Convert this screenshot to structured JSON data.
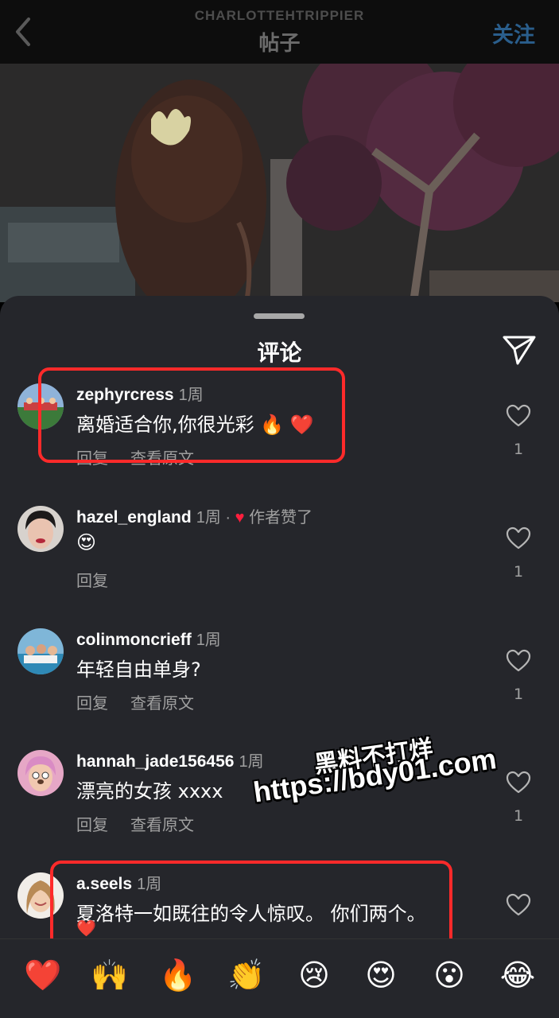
{
  "header": {
    "username": "CHARLOTTEHTRIPPIER",
    "title": "帖子",
    "follow_label": "关注"
  },
  "sheet": {
    "title": "评论"
  },
  "comments": [
    {
      "username": "zephyrcress",
      "time": "1周",
      "text": "离婚适合你,你很光彩 🔥 ❤️",
      "actions": [
        "回复",
        "查看原文"
      ],
      "likes": "1",
      "highlighted": true
    },
    {
      "username": "hazel_england",
      "time": "1周",
      "author_liked": "作者赞了",
      "author_liked_sep": "·",
      "author_liked_heart": "♥",
      "text": "😍",
      "actions": [
        "回复"
      ],
      "likes": "1"
    },
    {
      "username": "colinmoncrieff",
      "time": "1周",
      "text": "年轻自由单身?",
      "actions": [
        "回复",
        "查看原文"
      ],
      "likes": "1"
    },
    {
      "username": "hannah_jade156456",
      "time": "1周",
      "text": "漂亮的女孩 xxxx",
      "actions": [
        "回复",
        "查看原文"
      ],
      "likes": "1"
    },
    {
      "username": "a.seels",
      "time": "1周",
      "text": "夏洛特一如既往的令人惊叹。 你们两个。",
      "text_line2": "❤️",
      "highlighted": true
    }
  ],
  "watermark": {
    "line1": "黑料不打烊",
    "line2": "https://bdy01.com"
  },
  "emoji_bar": [
    "❤️",
    "🙌",
    "🔥",
    "👏",
    "😢",
    "😍",
    "😮",
    "😂"
  ],
  "colors": {
    "sheet_bg": "#25262b",
    "highlight": "#ff2a2a",
    "follow": "#2a5e8c",
    "secondary_text": "#a0a0a0"
  },
  "icons": [
    "back-chevron-icon",
    "share-send-icon",
    "heart-outline-icon",
    "heart-filled-icon"
  ]
}
